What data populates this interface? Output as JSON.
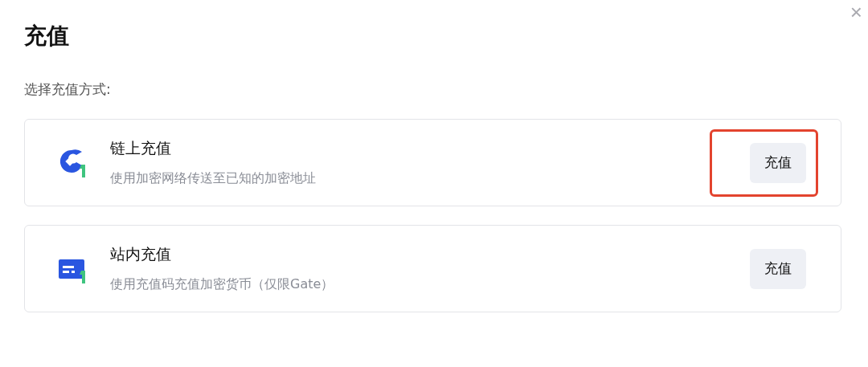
{
  "dialog": {
    "title": "充值",
    "close": "×"
  },
  "prompt": "选择充值方式:",
  "methods": [
    {
      "kind": "onchain",
      "title": "链上充值",
      "description": "使用加密网络传送至已知的加密地址",
      "button": "充值",
      "highlighted": true
    },
    {
      "kind": "internal",
      "title": "站内充值",
      "description": "使用充值码充值加密货币（仅限Gate）",
      "button": "充值",
      "highlighted": false
    }
  ]
}
